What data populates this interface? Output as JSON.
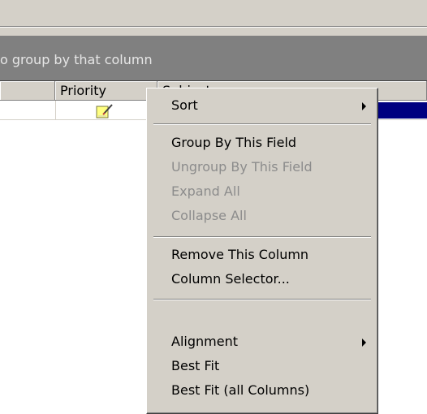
{
  "group_panel": {
    "hint": "o group by that column"
  },
  "columns": {
    "priority": "Priority",
    "subject": "Subject"
  },
  "context_menu": {
    "items": [
      {
        "label": "Sort",
        "enabled": true,
        "submenu": true
      },
      {
        "label": "Group By This Field",
        "enabled": true,
        "submenu": false
      },
      {
        "label": "Ungroup By This Field",
        "enabled": false,
        "submenu": false
      },
      {
        "label": "Expand All",
        "enabled": false,
        "submenu": false
      },
      {
        "label": "Collapse All",
        "enabled": false,
        "submenu": false
      },
      {
        "label": "Remove This Column",
        "enabled": true,
        "submenu": false
      },
      {
        "label": "Column Selector...",
        "enabled": true,
        "submenu": false
      },
      {
        "label": "Alignment",
        "enabled": true,
        "submenu": true
      },
      {
        "label": "Best Fit",
        "enabled": true,
        "submenu": false
      },
      {
        "label": "Best Fit (all Columns)",
        "enabled": true,
        "submenu": false
      }
    ]
  },
  "colors": {
    "selection": "#000080",
    "group_panel": "#808080",
    "menu_bg": "#d4d0c8",
    "disabled_text": "#8c8c8c"
  },
  "icons": {
    "priority_cell": "note-icon"
  }
}
